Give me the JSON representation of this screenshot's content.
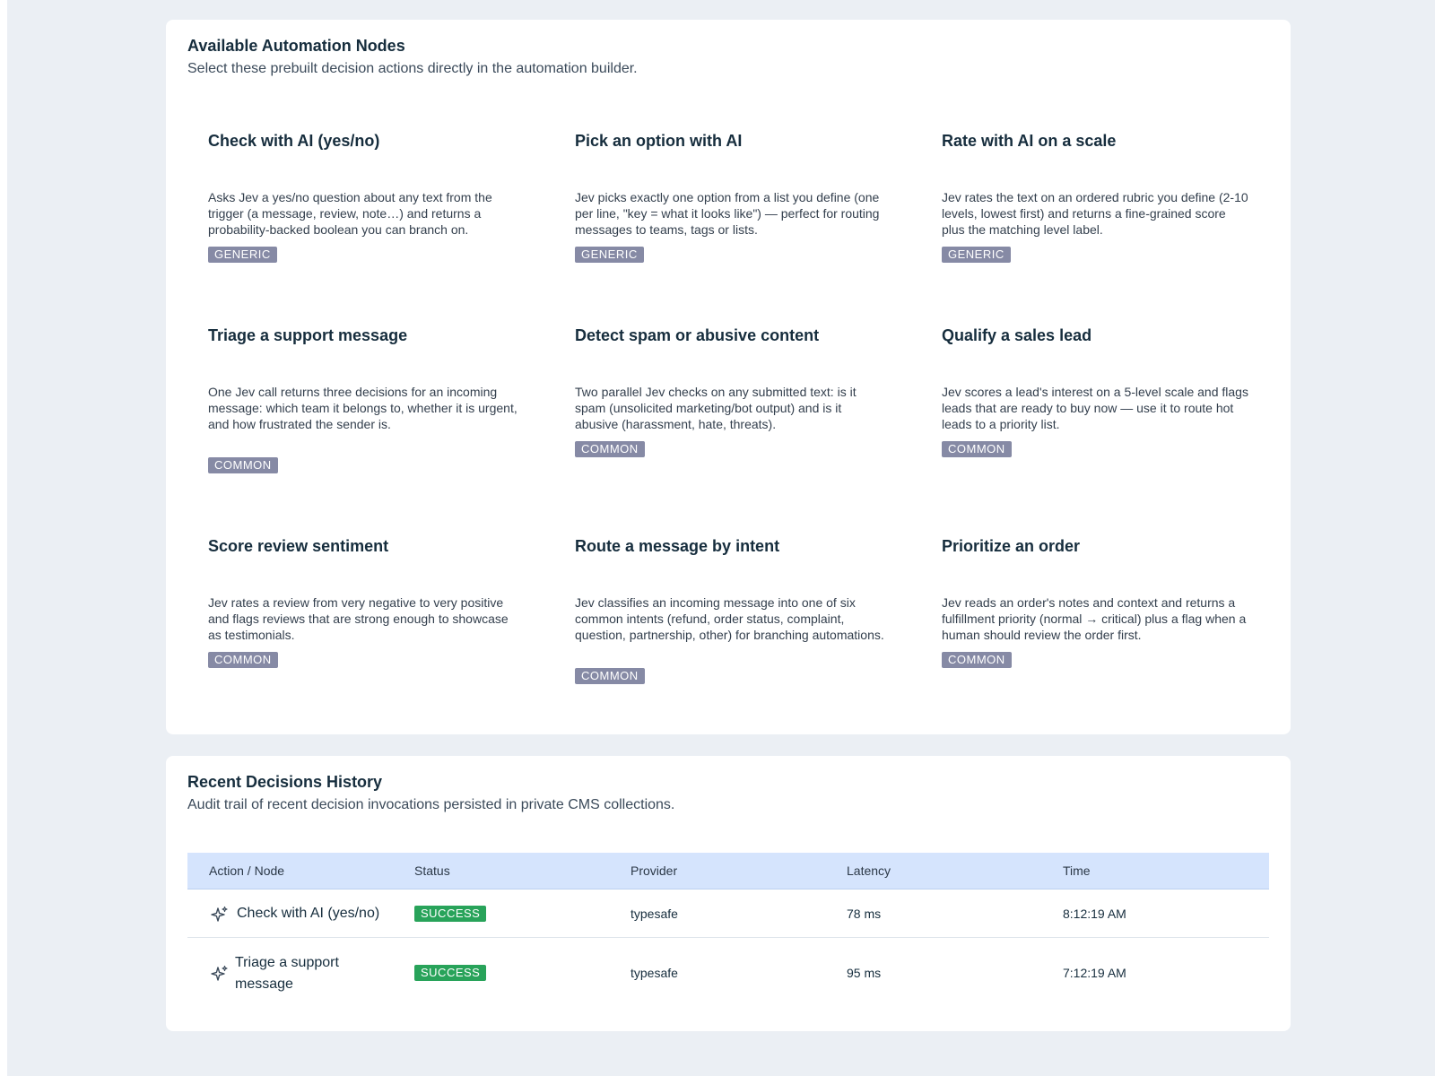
{
  "nodes_section": {
    "title": "Available Automation Nodes",
    "subtitle": "Select these prebuilt decision actions directly in the automation builder.",
    "nodes": [
      {
        "title": "Check with AI (yes/no)",
        "description": "Asks Jev a yes/no question about any text from the trigger (a message, review, note…) and returns a probability-backed boolean you can branch on.",
        "badge": "GENERIC"
      },
      {
        "title": "Pick an option with AI",
        "description": "Jev picks exactly one option from a list you define (one per line, \"key = what it looks like\") — perfect for routing messages to teams, tags or lists.",
        "badge": "GENERIC"
      },
      {
        "title": "Rate with AI on a scale",
        "description": "Jev rates the text on an ordered rubric you define (2-10 levels, lowest first) and returns a fine-grained score plus the matching level label.",
        "badge": "GENERIC"
      },
      {
        "title": "Triage a support message",
        "description": "One Jev call returns three decisions for an incoming message: which team it belongs to, whether it is urgent, and how frustrated the sender is.",
        "badge": "COMMON"
      },
      {
        "title": "Detect spam or abusive content",
        "description": "Two parallel Jev checks on any submitted text: is it spam (unsolicited marketing/bot output) and is it abusive (harassment, hate, threats).",
        "badge": "COMMON"
      },
      {
        "title": "Qualify a sales lead",
        "description": "Jev scores a lead's interest on a 5-level scale and flags leads that are ready to buy now — use it to route hot leads to a priority list.",
        "badge": "COMMON"
      },
      {
        "title": "Score review sentiment",
        "description": "Jev rates a review from very negative to very positive and flags reviews that are strong enough to showcase as testimonials.",
        "badge": "COMMON"
      },
      {
        "title": "Route a message by intent",
        "description": "Jev classifies an incoming message into one of six common intents (refund, order status, complaint, question, partnership, other) for branching automations.",
        "badge": "COMMON"
      },
      {
        "title": "Prioritize an order",
        "description": "Jev reads an order's notes and context and returns a fulfillment priority (normal → critical) plus a flag when a human should review the order first.",
        "badge": "COMMON"
      }
    ]
  },
  "history_section": {
    "title": "Recent Decisions History",
    "subtitle": "Audit trail of recent decision invocations persisted in private CMS collections.",
    "columns": [
      "Action / Node",
      "Status",
      "Provider",
      "Latency",
      "Time"
    ],
    "rows": [
      {
        "action": "Check with AI (yes/no)",
        "status": "SUCCESS",
        "provider": "typesafe",
        "latency": "78 ms",
        "time": "8:12:19 AM",
        "icon": "sparkle-icon"
      },
      {
        "action": "Triage a support message",
        "status": "SUCCESS",
        "provider": "typesafe",
        "latency": "95 ms",
        "time": "7:12:19 AM",
        "icon": "sparkle-icon"
      }
    ]
  },
  "colors": {
    "page_background": "#ebeff4",
    "card_background": "#ffffff",
    "badge_neutral": "#868aa5",
    "badge_success": "#28a35a",
    "table_header": "#d5e4fd"
  }
}
